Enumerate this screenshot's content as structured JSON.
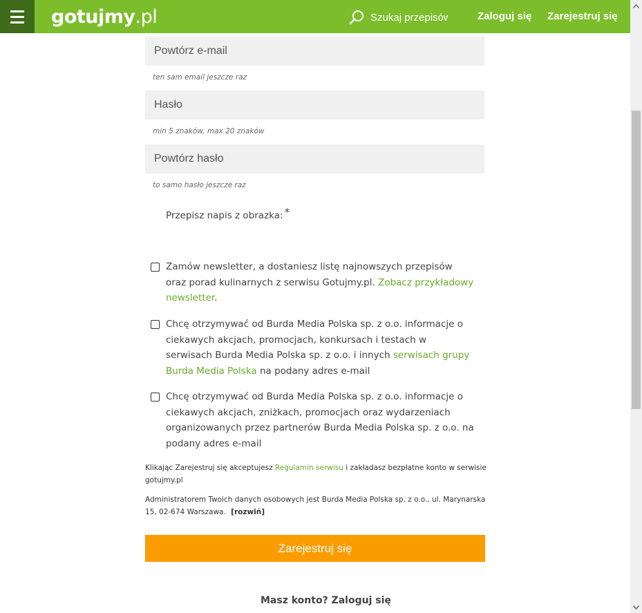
{
  "header": {
    "logo_bold": "gotujmy",
    "logo_light": ".pl",
    "search_placeholder": "Szukaj przepisów",
    "login_label": "Zaloguj się",
    "register_label": "Zarejestruj się",
    "brand_color": "#7cbd2b",
    "menu_color": "#3d6b1a"
  },
  "form": {
    "repeat_email_placeholder": "Powtórz e-mail",
    "repeat_email_hint": "ten sam email jeszcze raz",
    "password_placeholder": "Hasło",
    "password_hint": "min 5 znaków, max 20 znaków",
    "repeat_password_placeholder": "Powtórz hasło",
    "repeat_password_hint": "to samo hasło jeszcze raz",
    "captcha_label": "Przepisz napis z obrazka:",
    "captcha_required": "*",
    "newsletter": {
      "text": "Zamów newsletter, a dostaniesz listę najnowszych przepisów oraz porad kulinarnych z serwisu Gotujmy.pl.",
      "link": "Zobacz przykładowy newsletter",
      "suffix": "."
    },
    "consent_burda": {
      "text": "Chcę otrzymywać od Burda Media Polska sp. z o.o. informacje o ciekawych akcjach, promocjach, konkursach i testach w serwisach Burda Media Polska sp. z o.o. i innych",
      "link": "serwisach grupy Burda Media Polska",
      "suffix": "na podany adres e-mail"
    },
    "consent_partners": {
      "text": "Chcę otrzymywać od Burda Media Polska sp. z o.o. informacje o ciekawych akcjach, zniżkach, promocjach oraz wydarzeniach organizowanych przez partnerów Burda Media Polska sp. z o.o. na podany adres e-mail"
    },
    "terms": {
      "prefix": "Klikając Zarejestruj się akceptujesz",
      "link": "Regulamin serwisu",
      "suffix": "i zakładasz bezpłatne konto w serwisie gotujmy.pl"
    },
    "admin_info": {
      "text": "Administratorem Twoich danych osobowych jest Burda Media Polska sp. z o.o., ul. Marynarska 15, 02-674 Warszawa.",
      "expand": "[rozwiń]"
    },
    "submit_label": "Zarejestruj się",
    "submit_color": "#fa9c00",
    "login_prompt": "Masz konto? Zaloguj się"
  },
  "icons": {
    "menu": "hamburger-icon",
    "search": "magnifier-icon"
  }
}
